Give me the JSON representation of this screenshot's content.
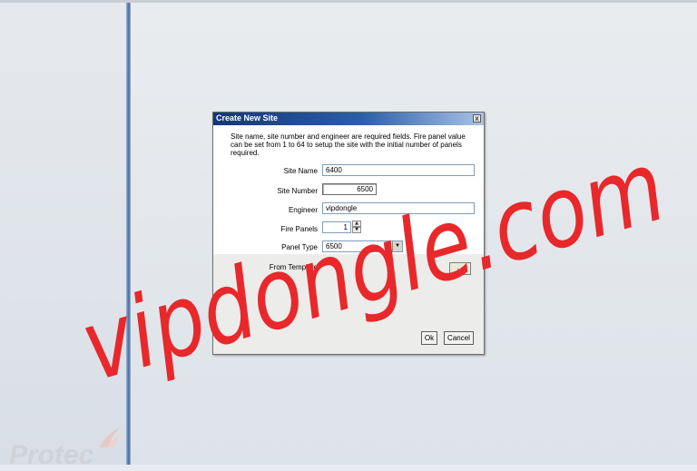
{
  "dialog": {
    "title": "Create New Site",
    "close_glyph": "x",
    "description": "Site name, site number and engineer are required fields. Fire panel value can be set from 1 to 64 to setup the site with the initial number of panels required.",
    "site_name": {
      "label": "Site Name",
      "value": "6400"
    },
    "site_number": {
      "label": "Site Number",
      "value": "6500"
    },
    "engineer": {
      "label": "Engineer",
      "value": "vipdongle"
    },
    "fire_panels": {
      "label": "Fire Panels",
      "value": "1"
    },
    "panel_type": {
      "label": "Panel Type",
      "value": "6500"
    },
    "from_template": {
      "label": "From Template",
      "browse_label": "..."
    },
    "ok_label": "Ok",
    "cancel_label": "Cancel"
  },
  "logo": {
    "text": "Protec"
  },
  "watermark": {
    "text": "vipdongle.com",
    "color": "#e8282b"
  },
  "colors": {
    "titlebar": "#13377b",
    "splitter": "#5e7eae",
    "background": "#e3e7eb"
  },
  "icons": [
    "close-icon",
    "spin-up-icon",
    "spin-down-icon",
    "dropdown-arrow-icon"
  ]
}
